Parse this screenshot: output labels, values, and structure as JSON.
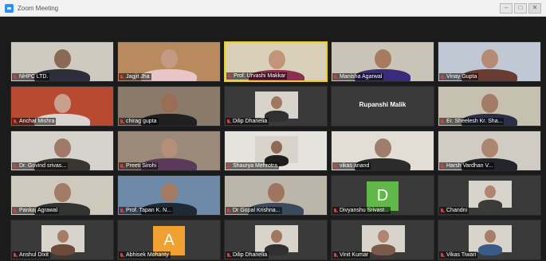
{
  "window": {
    "title": "Zoom Meeting",
    "controls": [
      "–",
      "□",
      "✕"
    ]
  },
  "participants": [
    {
      "name": "NHPC LTD.",
      "bg": "#cfcac0",
      "shirt": "#2e2e3a",
      "skin": "#8a6a55"
    },
    {
      "name": "Jagjit Jha",
      "bg": "#b98a5e",
      "shirt": "#e8c6c6",
      "skin": "#c49a84"
    },
    {
      "name": "Prof. Urvashi Makkar",
      "bg": "#d8d0b8",
      "shirt": "#8a2f4f",
      "skin": "#c29478",
      "active": true
    },
    {
      "name": "Manisha Agarwal",
      "bg": "#c9c3b8",
      "shirt": "#3a2c7a",
      "skin": "#a87a62"
    },
    {
      "name": "Vinay Gupta",
      "bg": "#c0c8d4",
      "shirt": "#6a3b33",
      "skin": "#b68a74"
    },
    {
      "name": "Anchal Mishra",
      "bg": "#b84a32",
      "shirt": "#d9d4cf",
      "skin": "#c9a08c"
    },
    {
      "name": "chirag gupta",
      "bg": "#8a7a6a",
      "shirt": "#202020",
      "skin": "#9a6e55"
    },
    {
      "name": "Dilip Dhanelia",
      "bg": "#3a3a3a",
      "shirt": "#303030",
      "skin": "#a07860",
      "small": true
    },
    {
      "name": "Rupanshi Malik",
      "bg": "#3a3a3a",
      "centerName": true
    },
    {
      "name": "Er. Sheelesh Kr. Sha...",
      "bg": "#c6c0b0",
      "shirt": "#2c2f48",
      "skin": "#a37c66"
    },
    {
      "name": "Dr. Govind srivas...",
      "bg": "#d6d3cc",
      "shirt": "#3a3530",
      "skin": "#a07a66"
    },
    {
      "name": "Preeti Sirohi",
      "bg": "#9b8a7a",
      "shirt": "#5a3a5a",
      "skin": "#b58f78"
    },
    {
      "name": "Shaurya Mehrotra",
      "bg": "#e5e3dd",
      "shirt": "#1e1e1e",
      "skin": "#8e6a56",
      "small": true
    },
    {
      "name": "vikas anand",
      "bg": "#e2ded6",
      "shirt": "#2b2b2b",
      "skin": "#a07c6a"
    },
    {
      "name": "Harsh Vardhan V...",
      "bg": "#d0ccc4",
      "shirt": "#23252c",
      "skin": "#ad8670"
    },
    {
      "name": "Pankaj Agrawal",
      "bg": "#cfc9bd",
      "shirt": "#333",
      "skin": "#a07c66"
    },
    {
      "name": "Prof. Tapan K. N...",
      "bg": "#6d8aa8",
      "shirt": "#1f2a36",
      "skin": "#a47a62"
    },
    {
      "name": "Dr Gopal Krishna...",
      "bg": "#bcb6aa",
      "shirt": "#3c4a5e",
      "skin": "#9e7660"
    },
    {
      "name": "Divyanshu Srivast...",
      "bg": "#3a3a3a",
      "avatarLetter": "D",
      "avatarColor": "#5fb847"
    },
    {
      "name": "Chandni",
      "bg": "#3a3a3a",
      "shirt": "#3b3b3b",
      "skin": "#b08670",
      "small": true
    },
    {
      "name": "Anshul Dixit",
      "bg": "#3a3a3a",
      "shirt": "#6d4a3a",
      "skin": "#a77c66",
      "small": true
    },
    {
      "name": "Abhisek Mohanty",
      "bg": "#3a3a3a",
      "avatarLetter": "A",
      "avatarColor": "#f0a132"
    },
    {
      "name": "Dilip Dhanelia",
      "bg": "#3a3a3a",
      "shirt": "#303030",
      "skin": "#a07860",
      "small": true
    },
    {
      "name": "Vinit Kumar",
      "bg": "#3a3a3a",
      "shirt": "#7a5a4a",
      "skin": "#b08672",
      "small": true
    },
    {
      "name": "Vikas Tiwari",
      "bg": "#3a3a3a",
      "shirt": "#3a5a8a",
      "skin": "#a87e68",
      "small": true
    }
  ]
}
